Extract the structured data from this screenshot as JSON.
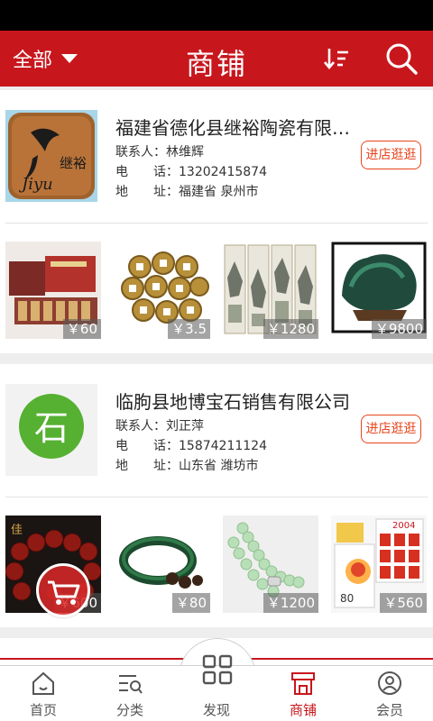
{
  "header": {
    "filter_label": "全部",
    "title": "商铺"
  },
  "shops": [
    {
      "name": "福建省德化县继裕陶瓷有限公...",
      "contact_label": "联系人：",
      "contact": "林维辉",
      "phone_label": "电　　话：",
      "phone": "13202415874",
      "address_label": "地　　址：",
      "address": "福建省 泉州市",
      "logo_text": "继裕",
      "logo_sub": "Jiyu",
      "enter_label": "进店逛逛",
      "products": [
        {
          "price": "￥60"
        },
        {
          "price": "￥3.5"
        },
        {
          "price": "￥1280"
        },
        {
          "price": "￥9800"
        }
      ]
    },
    {
      "name": "临朐县地博宝石销售有限公司",
      "contact_label": "联系人：",
      "contact": "刘正萍",
      "phone_label": "电　　话：",
      "phone": "15874211124",
      "address_label": "地　　址：",
      "address": "山东省 潍坊市",
      "logo_text": "石",
      "enter_label": "进店逛逛",
      "products": [
        {
          "price": "￥600"
        },
        {
          "price": "￥80"
        },
        {
          "price": "￥1200"
        },
        {
          "price": "￥560"
        }
      ]
    }
  ],
  "stamp_text": {
    "year": "2004",
    "value": "80"
  },
  "tabbar": {
    "items": [
      {
        "label": "首页",
        "icon": "home-icon"
      },
      {
        "label": "分类",
        "icon": "category-icon"
      },
      {
        "label": "发现",
        "icon": "discover-icon"
      },
      {
        "label": "商铺",
        "icon": "shop-icon"
      },
      {
        "label": "会员",
        "icon": "member-icon"
      }
    ]
  },
  "colors": {
    "brand_red": "#c8161d",
    "button_orange": "#e8451c"
  }
}
